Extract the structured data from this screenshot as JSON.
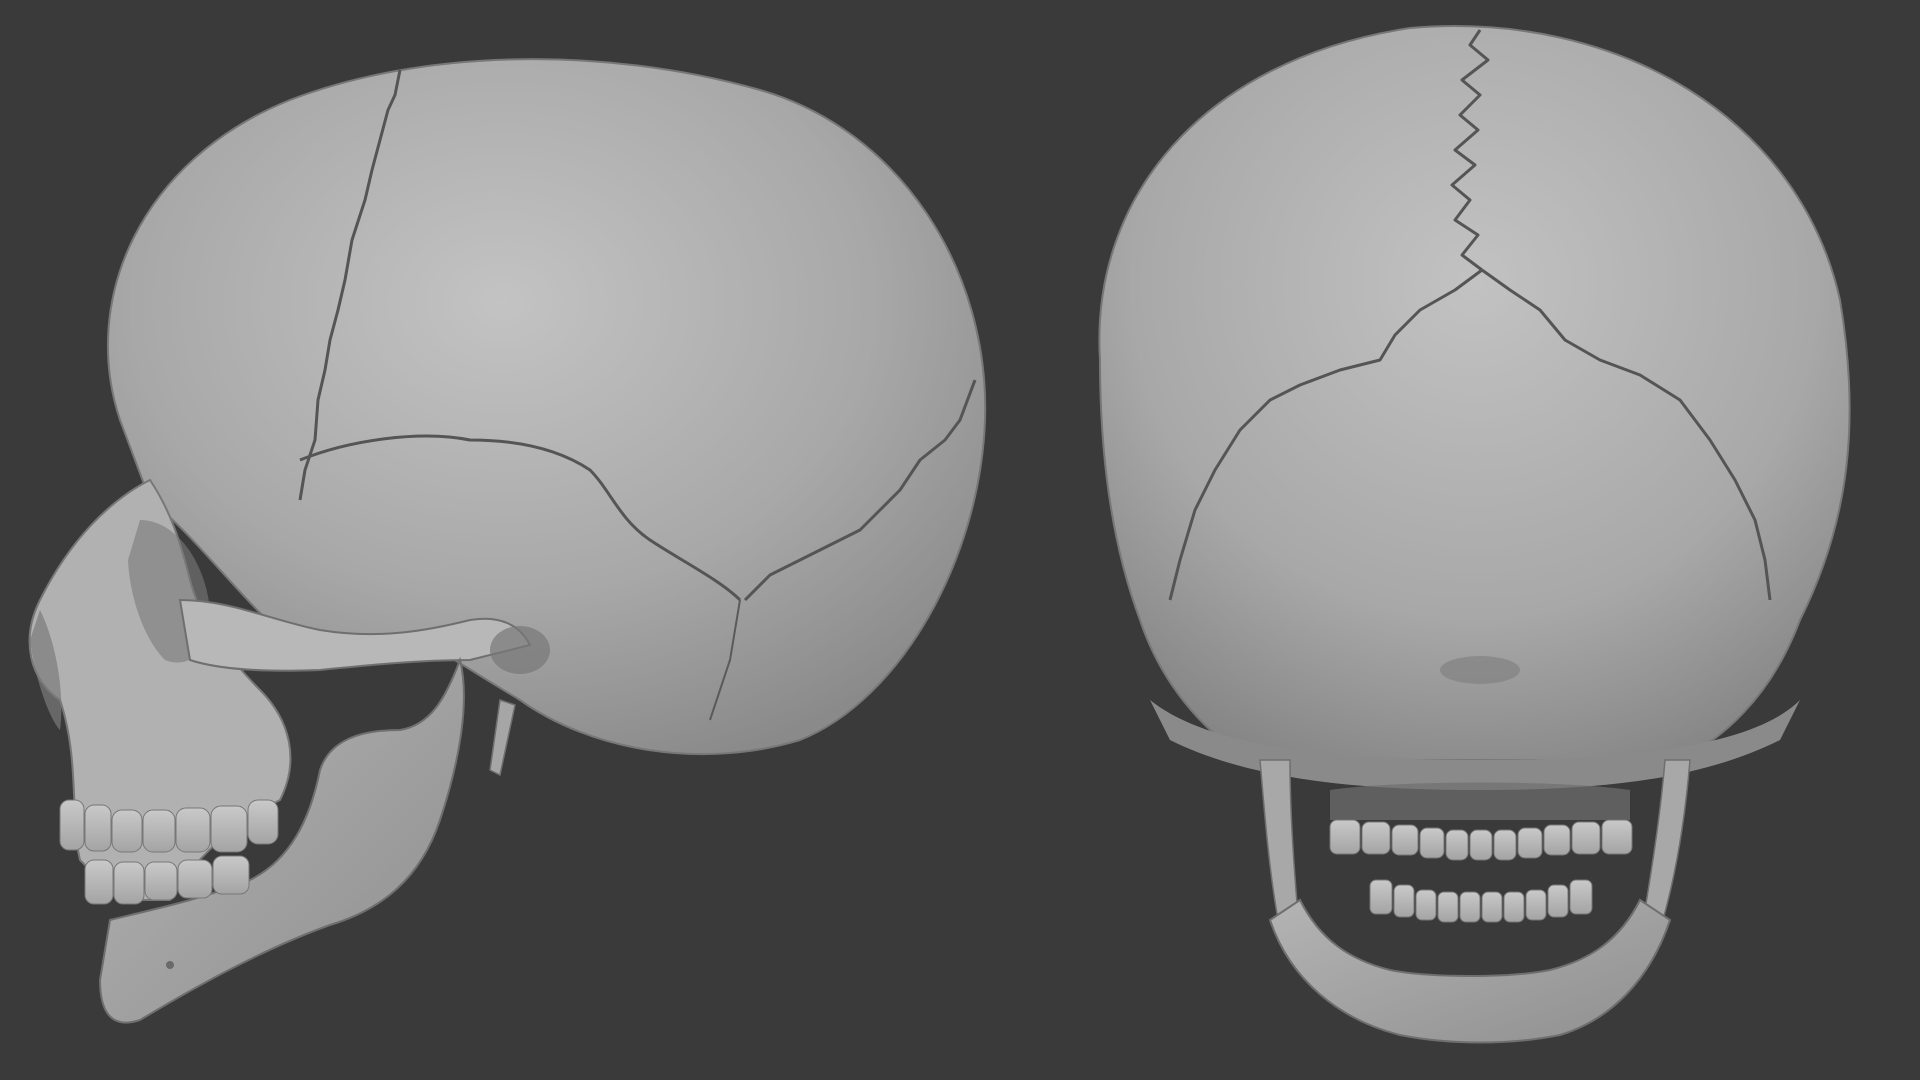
{
  "viewport": {
    "background_color": "#3a3a3a"
  },
  "render": {
    "material_color": "#a9a9a9",
    "highlight_color": "#c7c7c7",
    "shadow_color": "#6e6e6e",
    "suture_color": "#555555"
  },
  "models": [
    {
      "name": "skull-lateral-view",
      "view": "left side"
    },
    {
      "name": "skull-posterior-view",
      "view": "back"
    }
  ]
}
